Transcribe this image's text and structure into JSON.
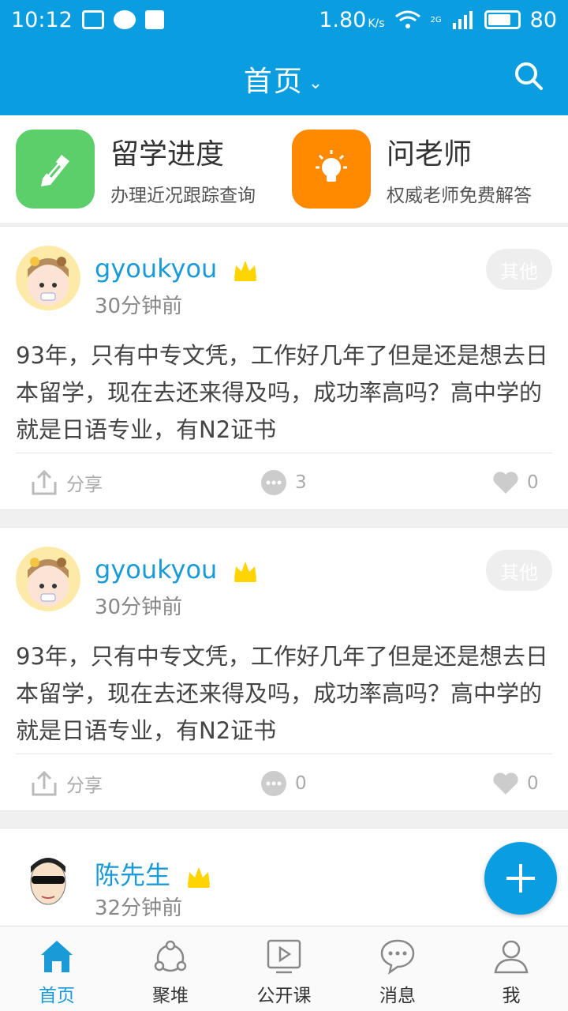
{
  "status_bar": {
    "time": "10:12",
    "speed": "1.80",
    "speed_unit": "K/s",
    "net": "2G",
    "battery": "80"
  },
  "header": {
    "title": "首页",
    "search_icon": "search-icon"
  },
  "quick": [
    {
      "title": "留学进度",
      "subtitle": "办理近况跟踪查询",
      "icon": "pencil-icon",
      "color": "#5ccf6b"
    },
    {
      "title": "问老师",
      "subtitle": "权威老师免费解答",
      "icon": "lightbulb-icon",
      "color": "#ff8a00"
    }
  ],
  "posts": [
    {
      "username": "gyoukyou",
      "time": "30分钟前",
      "tag": "其他",
      "content": "93年，只有中专文凭，工作好几年了但是还是想去日本留学，现在去还来得及吗，成功率高吗？高中学的就是日语专业，有N2证书",
      "share_label": "分享",
      "comments": "3",
      "likes": "0"
    },
    {
      "username": "gyoukyou",
      "time": "30分钟前",
      "tag": "其他",
      "content": "93年，只有中专文凭，工作好几年了但是还是想去日本留学，现在去还来得及吗，成功率高吗？高中学的就是日语专业，有N2证书",
      "share_label": "分享",
      "comments": "0",
      "likes": "0"
    },
    {
      "username": "陈先生",
      "time": "32分钟前"
    }
  ],
  "tabs": [
    {
      "label": "首页",
      "icon": "home-icon"
    },
    {
      "label": "聚堆",
      "icon": "community-icon"
    },
    {
      "label": "公开课",
      "icon": "video-icon"
    },
    {
      "label": "消息",
      "icon": "message-icon"
    },
    {
      "label": "我",
      "icon": "profile-icon"
    }
  ],
  "colors": {
    "accent": "#0a9de0",
    "username": "#1a9bd7",
    "crown": "#ffd400"
  }
}
